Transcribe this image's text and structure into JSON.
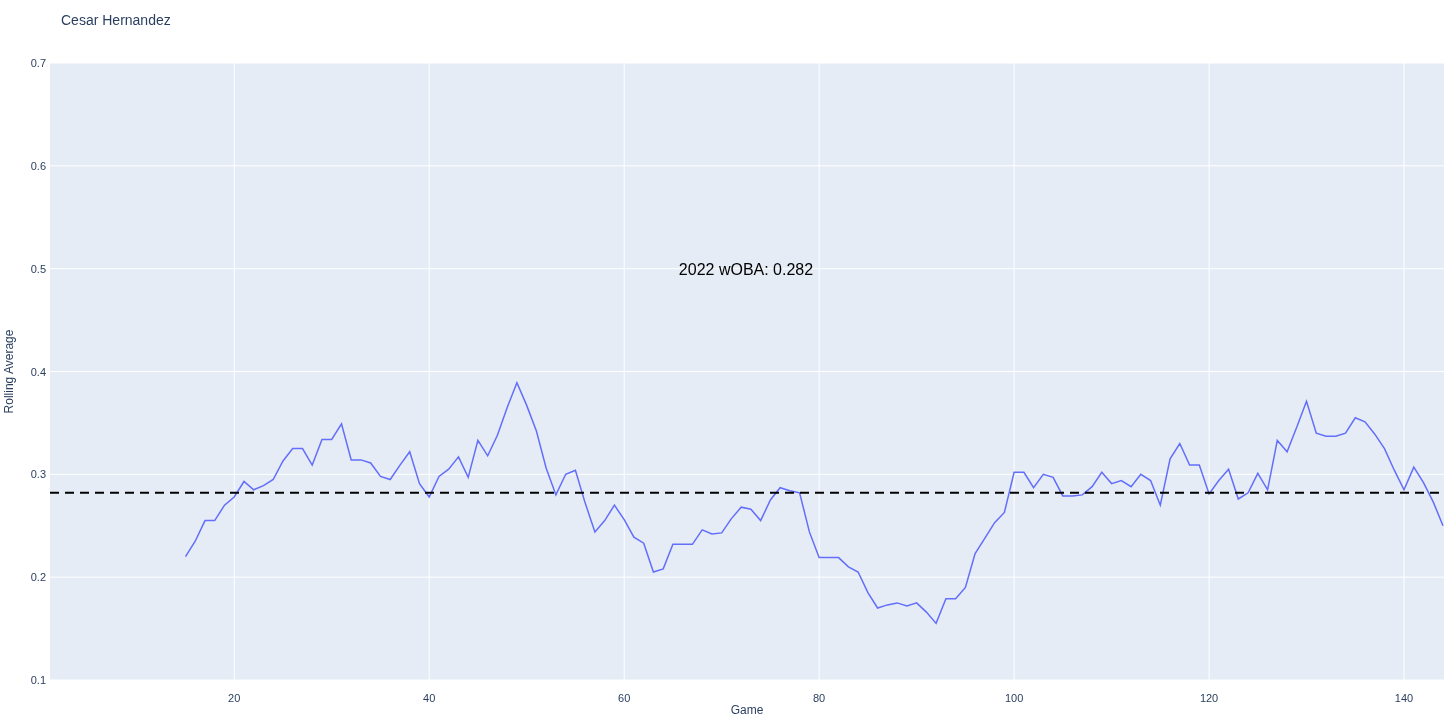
{
  "title": "Cesar Hernandez",
  "chart": {
    "chart_data": {
      "type": "line",
      "xlabel": "Game",
      "ylabel": "Rolling Average",
      "xlim": [
        1.1,
        144.1
      ],
      "ylim": [
        0.1,
        0.7
      ],
      "xticks": [
        20,
        40,
        60,
        80,
        100,
        120,
        140
      ],
      "yticks": [
        0.1,
        0.2,
        0.3,
        0.4,
        0.5,
        0.6,
        0.7
      ],
      "x": [
        15,
        16,
        17,
        18,
        19,
        20,
        21,
        22,
        23,
        24,
        25,
        26,
        27,
        28,
        29,
        30,
        31,
        32,
        33,
        34,
        35,
        36,
        37,
        38,
        39,
        40,
        41,
        42,
        43,
        44,
        45,
        46,
        47,
        48,
        49,
        50,
        51,
        52,
        53,
        54,
        55,
        56,
        57,
        58,
        59,
        60,
        61,
        62,
        63,
        64,
        65,
        66,
        67,
        68,
        69,
        70,
        71,
        72,
        73,
        74,
        75,
        76,
        77,
        78,
        79,
        80,
        81,
        82,
        83,
        84,
        85,
        86,
        87,
        88,
        89,
        90,
        91,
        92,
        93,
        94,
        95,
        96,
        97,
        98,
        99,
        100,
        101,
        102,
        103,
        104,
        105,
        106,
        107,
        108,
        109,
        110,
        111,
        112,
        113,
        114,
        115,
        116,
        117,
        118,
        119,
        120,
        121,
        122,
        123,
        124,
        125,
        126,
        127,
        128,
        129,
        130,
        131,
        132,
        133,
        134,
        135,
        136,
        137,
        138,
        139,
        140,
        141,
        142,
        143,
        144
      ],
      "series": [
        {
          "color": "#636efa",
          "values": [
            0.22,
            0.235,
            0.255,
            0.255,
            0.27,
            0.278,
            0.293,
            0.285,
            0.289,
            0.295,
            0.313,
            0.325,
            0.325,
            0.309,
            0.334,
            0.334,
            0.349,
            0.314,
            0.314,
            0.311,
            0.298,
            0.295,
            0.309,
            0.322,
            0.291,
            0.278,
            0.298,
            0.305,
            0.317,
            0.297,
            0.333,
            0.318,
            0.338,
            0.365,
            0.389,
            0.367,
            0.342,
            0.306,
            0.28,
            0.3,
            0.304,
            0.272,
            0.244,
            0.255,
            0.27,
            0.256,
            0.239,
            0.233,
            0.205,
            0.208,
            0.232,
            0.232,
            0.232,
            0.246,
            0.242,
            0.243,
            0.257,
            0.268,
            0.266,
            0.255,
            0.275,
            0.287,
            0.284,
            0.282,
            0.244,
            0.219,
            0.219,
            0.219,
            0.21,
            0.205,
            0.185,
            0.17,
            0.173,
            0.175,
            0.172,
            0.175,
            0.166,
            0.155,
            0.179,
            0.179,
            0.19,
            0.223,
            0.238,
            0.253,
            0.263,
            0.302,
            0.302,
            0.287,
            0.3,
            0.297,
            0.279,
            0.279,
            0.28,
            0.288,
            0.302,
            0.291,
            0.294,
            0.288,
            0.3,
            0.294,
            0.27,
            0.315,
            0.33,
            0.309,
            0.309,
            0.281,
            0.294,
            0.305,
            0.276,
            0.282,
            0.301,
            0.285,
            0.333,
            0.322,
            0.346,
            0.371,
            0.34,
            0.337,
            0.337,
            0.34,
            0.355,
            0.351,
            0.339,
            0.325,
            0.304,
            0.285,
            0.307,
            0.292,
            0.273,
            0.25
          ]
        }
      ],
      "grid": true,
      "ref_lines": [
        {
          "axis": "y",
          "value": 0.282,
          "color": "#000000"
        }
      ],
      "annotations": [
        "2022 wOBA: 0.282"
      ]
    }
  }
}
